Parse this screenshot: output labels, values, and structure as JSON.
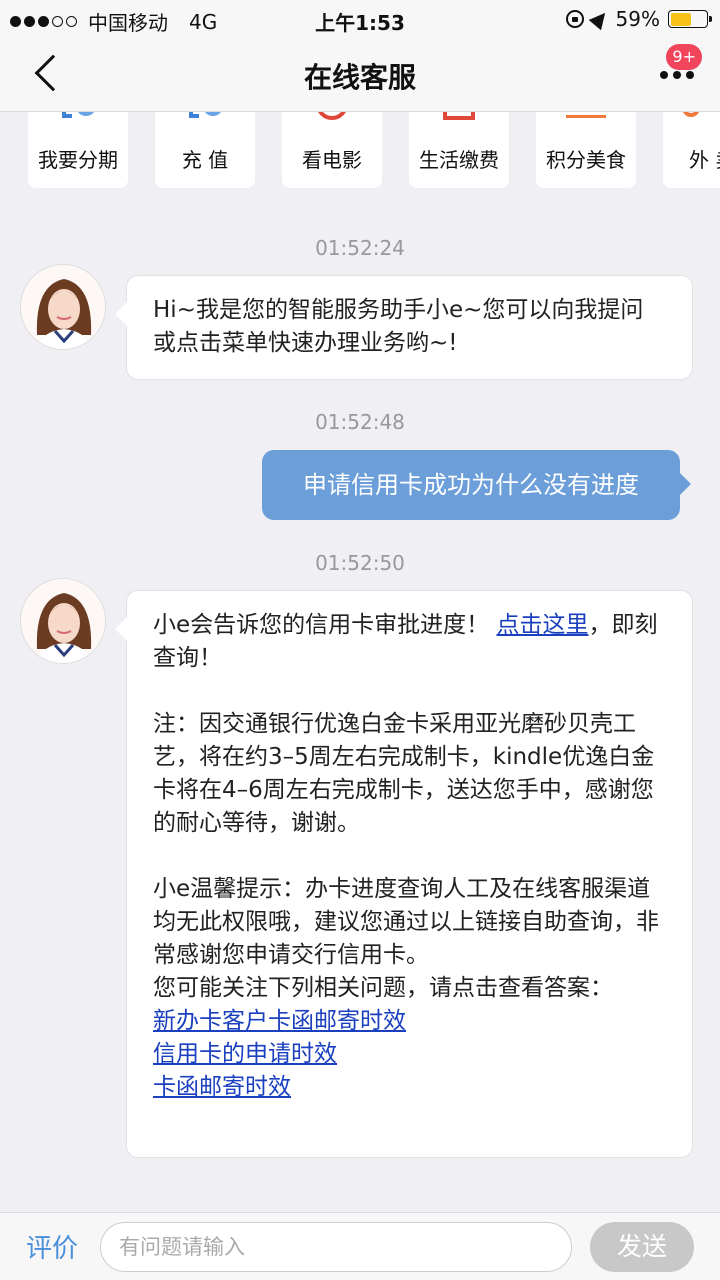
{
  "status_bar": {
    "carrier": "中国移动",
    "network": "4G",
    "time": "上午1:53",
    "battery": "59%",
    "battery_level": 0.59
  },
  "nav": {
    "title": "在线客服",
    "badge": "9+"
  },
  "quick_menu": [
    {
      "label": "我要分期",
      "icon": "installment-icon"
    },
    {
      "label": "充 值",
      "icon": "recharge-icon"
    },
    {
      "label": "看电影",
      "icon": "movie-icon"
    },
    {
      "label": "生活缴费",
      "icon": "bill-icon"
    },
    {
      "label": "积分美食",
      "icon": "food-icon"
    },
    {
      "label": "外 卖",
      "icon": "takeout-icon"
    }
  ],
  "messages": {
    "ts1": "01:52:24",
    "m1": "Hi~我是您的智能服务助手小e~您可以向我提问或点击菜单快速办理业务哟~!",
    "ts2": "01:52:48",
    "m2": "申请信用卡成功为什么没有进度",
    "ts3": "01:52:50",
    "m3": {
      "intro": "小e会告诉您的信用卡审批进度！ ",
      "intro_link": "点击这里",
      "intro_tail": "，即刻查询！",
      "note": "注：因交通银行优逸白金卡采用亚光磨砂贝壳工艺，将在约3–5周左右完成制卡，kindle优逸白金卡将在4–6周左右完成制卡，送达您手中，感谢您的耐心等待，谢谢。",
      "tip": "小e温馨提示：办卡进度查询人工及在线客服渠道均无此权限哦，建议您通过以上链接自助查询，非常感谢您申请交行信用卡。",
      "related": "您可能关注下列相关问题，请点击查看答案：",
      "links": [
        "新办卡客户卡函邮寄时效",
        "信用卡的申请时效",
        "卡函邮寄时效"
      ]
    }
  },
  "bottom": {
    "rate": "评价",
    "placeholder": "有问题请输入",
    "send": "发送"
  },
  "colors": {
    "accent": "#4a8fdc",
    "user_bubble": "#6c9ed9",
    "link": "#1a3fbf",
    "badge": "#f0455a"
  }
}
